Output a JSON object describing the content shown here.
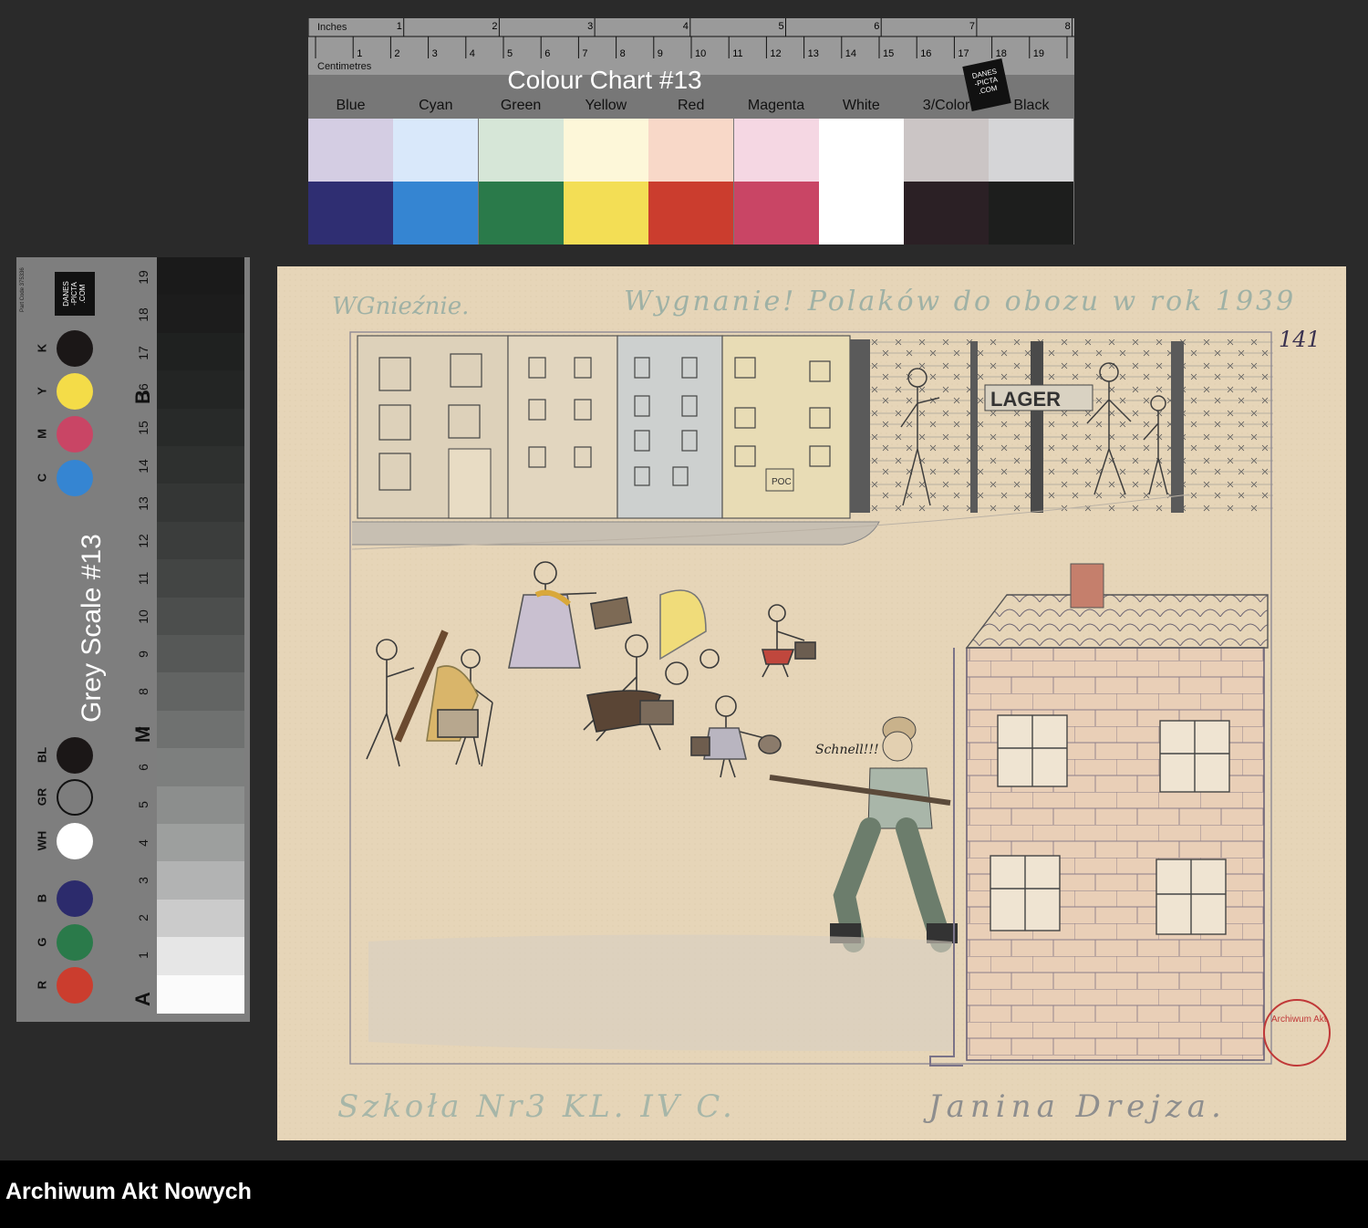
{
  "colour_chart": {
    "ruler_inches_label": "Inches",
    "ruler_cm_label": "Centimetres",
    "title": "Colour Chart #13",
    "logo_text": [
      "DANES",
      "-PICTA",
      ".COM"
    ],
    "swatches": [
      {
        "name": "Blue",
        "light": "#d4cde3",
        "dark": "#2f2e72"
      },
      {
        "name": "Cyan",
        "light": "#d9e8fa",
        "dark": "#3585d2"
      },
      {
        "name": "Green",
        "light": "#d6e6d7",
        "dark": "#2a7a4a"
      },
      {
        "name": "Yellow",
        "light": "#fdf7d9",
        "dark": "#f3de55"
      },
      {
        "name": "Red",
        "light": "#f8d8c8",
        "dark": "#cb3d2e"
      },
      {
        "name": "Magenta",
        "light": "#f5d7e3",
        "dark": "#c94565"
      },
      {
        "name": "White",
        "light": "#ffffff",
        "dark": "#ffffff"
      },
      {
        "name": "3/Color",
        "light": "#cbc5c5",
        "dark": "#2b2025"
      },
      {
        "name": "Black",
        "light": "#d5d5d7",
        "dark": "#1d1e1d"
      }
    ]
  },
  "grey_scale": {
    "title": "Grey Scale #13",
    "logo_text": [
      "DANES",
      "-PICTA",
      ".COM"
    ],
    "part_code": "Part Code 375336",
    "color_patches": [
      {
        "code": "K",
        "color": "#1b1717"
      },
      {
        "code": "Y",
        "color": "#f4dc48"
      },
      {
        "code": "M",
        "color": "#c94565"
      },
      {
        "code": "C",
        "color": "#3585d2"
      },
      {
        "code": "BL",
        "color": "#1b1717"
      },
      {
        "code": "GR",
        "color": "#7d7d7d"
      },
      {
        "code": "WH",
        "color": "#ffffff"
      },
      {
        "code": "B",
        "color": "#2c2b6c"
      },
      {
        "code": "G",
        "color": "#2a7a4a"
      },
      {
        "code": "R",
        "color": "#cb3d2e"
      }
    ],
    "numbers": [
      "19",
      "18",
      "17",
      "16",
      "15",
      "14",
      "13",
      "12",
      "11",
      "10",
      "9",
      "8",
      "7",
      "6",
      "5",
      "4",
      "3",
      "2",
      "1"
    ],
    "letters": [
      "B",
      "M",
      "A"
    ],
    "patches": [
      "#1a1a1a",
      "#1c1c1c",
      "#1f2120",
      "#232524",
      "#282a29",
      "#2e302f",
      "#343635",
      "#3b3d3c",
      "#434544",
      "#4c4e4d",
      "#565857",
      "#626463",
      "#6f7170",
      "#7d7f7e",
      "#8c8e8d",
      "#9d9f9e",
      "#b2b3b3",
      "#cbcbcb",
      "#e6e6e6",
      "#fbfbfb"
    ]
  },
  "drawing": {
    "caption_left": "WGnieźnie.",
    "caption_right": "Wygnanie! Polaków do obozu w rok 1939",
    "archive_number": "141",
    "lager_sign": "LAGER",
    "shop_sign": "POC",
    "soldier_shout": "Schnell!!!",
    "school": "Szkoła Nr3 KL. IV C.",
    "author": "Janina Drejza.",
    "stamp_text": "Archiwum Akt"
  },
  "footer": {
    "archive_name": "Archiwum Akt Nowych"
  }
}
